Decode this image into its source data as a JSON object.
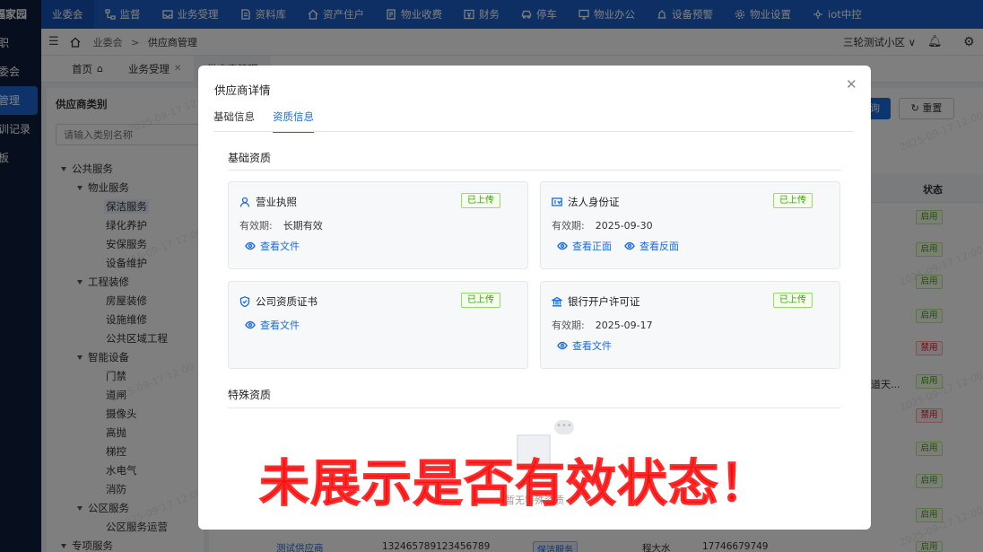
{
  "brand": "福家园",
  "topnav": {
    "items": [
      {
        "label": "业委会",
        "icon": "none",
        "active": true
      },
      {
        "label": "监督",
        "icon": "hierarchy-icon"
      },
      {
        "label": "业务受理",
        "icon": "inbox-icon"
      },
      {
        "label": "资料库",
        "icon": "document-icon"
      },
      {
        "label": "资产住户",
        "icon": "home-icon"
      },
      {
        "label": "物业收费",
        "icon": "receipt-icon"
      },
      {
        "label": "财务",
        "icon": "finance-icon"
      },
      {
        "label": "停车",
        "icon": "car-icon"
      },
      {
        "label": "物业办公",
        "icon": "monitor-icon"
      },
      {
        "label": "设备预警",
        "icon": "alarm-icon"
      },
      {
        "label": "物业设置",
        "icon": "gear-icon"
      },
      {
        "label": "iot中控",
        "icon": "iot-icon"
      }
    ]
  },
  "sidebar": {
    "items": [
      {
        "label": "职"
      },
      {
        "label": "委会"
      },
      {
        "label": "管理",
        "active": true
      },
      {
        "label": "训记录"
      },
      {
        "label": "板"
      }
    ]
  },
  "header": {
    "breadcrumb": [
      "业委会",
      "供应商管理"
    ],
    "community": "三轮测试小区"
  },
  "page_tabs": [
    {
      "label": "首页"
    },
    {
      "label": "业务受理"
    },
    {
      "label": "供应商管理"
    }
  ],
  "category_panel": {
    "title": "供应商类别",
    "search_placeholder": "请输入类别名称",
    "tree": [
      {
        "label": "公共服务",
        "level": 0,
        "expanded": true
      },
      {
        "label": "物业服务",
        "level": 1,
        "expanded": true
      },
      {
        "label": "保洁服务",
        "level": 2,
        "selected": true
      },
      {
        "label": "绿化养护",
        "level": 2
      },
      {
        "label": "安保服务",
        "level": 2
      },
      {
        "label": "设备维护",
        "level": 2
      },
      {
        "label": "工程装修",
        "level": 1,
        "expanded": true
      },
      {
        "label": "房屋装修",
        "level": 2
      },
      {
        "label": "设施维修",
        "level": 2
      },
      {
        "label": "公共区域工程",
        "level": 2
      },
      {
        "label": "智能设备",
        "level": 1,
        "expanded": true
      },
      {
        "label": "门禁",
        "level": 2
      },
      {
        "label": "道闸",
        "level": 2
      },
      {
        "label": "摄像头",
        "level": 2
      },
      {
        "label": "高抛",
        "level": 2
      },
      {
        "label": "梯控",
        "level": 2
      },
      {
        "label": "水电气",
        "level": 2
      },
      {
        "label": "消防",
        "level": 2
      },
      {
        "label": "公区服务",
        "level": 1,
        "expanded": true
      },
      {
        "label": "公区服务运营",
        "level": 2
      },
      {
        "label": "专项服务",
        "level": 0,
        "expanded": true
      }
    ]
  },
  "main": {
    "query_button": "询",
    "reset_button": "重置",
    "status_header": "状态",
    "address_fragment": "道天...",
    "statuses": [
      "启用",
      "启用",
      "启用",
      "启用",
      "禁用",
      "启用",
      "禁用",
      "启用",
      "启用",
      "启用",
      "启用"
    ],
    "last_row": {
      "name": "测试供应商",
      "code": "132465789123456789",
      "category": "保洁服务",
      "contact": "程大水",
      "phone": "17746679749"
    }
  },
  "watermark": "2025-09-17 12:00",
  "modal": {
    "title": "供应商详情",
    "tabs": [
      {
        "label": "基础信息"
      },
      {
        "label": "资质信息",
        "active": true
      }
    ],
    "basic_section_title": "基础资质",
    "cards": [
      {
        "title": "营业执照",
        "icon": "person-icon",
        "status": "已上传",
        "validity_label": "有效期:",
        "validity": "长期有效",
        "links": [
          "查看文件"
        ]
      },
      {
        "title": "法人身份证",
        "icon": "id-card-icon",
        "status": "已上传",
        "validity_label": "有效期:",
        "validity": "2025-09-30",
        "links": [
          "查看正面",
          "查看反面"
        ]
      },
      {
        "title": "公司资质证书",
        "icon": "shield-icon",
        "status": "已上传",
        "validity_label": "",
        "validity": "",
        "links": [
          "查看文件"
        ]
      },
      {
        "title": "银行开户许可证",
        "icon": "bank-icon",
        "status": "已上传",
        "validity_label": "有效期:",
        "validity": "2025-09-17",
        "links": [
          "查看文件"
        ]
      }
    ],
    "special_section_title": "特殊资质",
    "empty_text": "暂无特殊资质"
  },
  "annotation": "未展示是否有效状态！",
  "colors": {
    "primary": "#1a6be0",
    "nav": "#1a5fc9",
    "sidebar": "#0e1d3a",
    "annotation": "#f01010",
    "success": "#389e0d",
    "danger": "#cf1322"
  }
}
